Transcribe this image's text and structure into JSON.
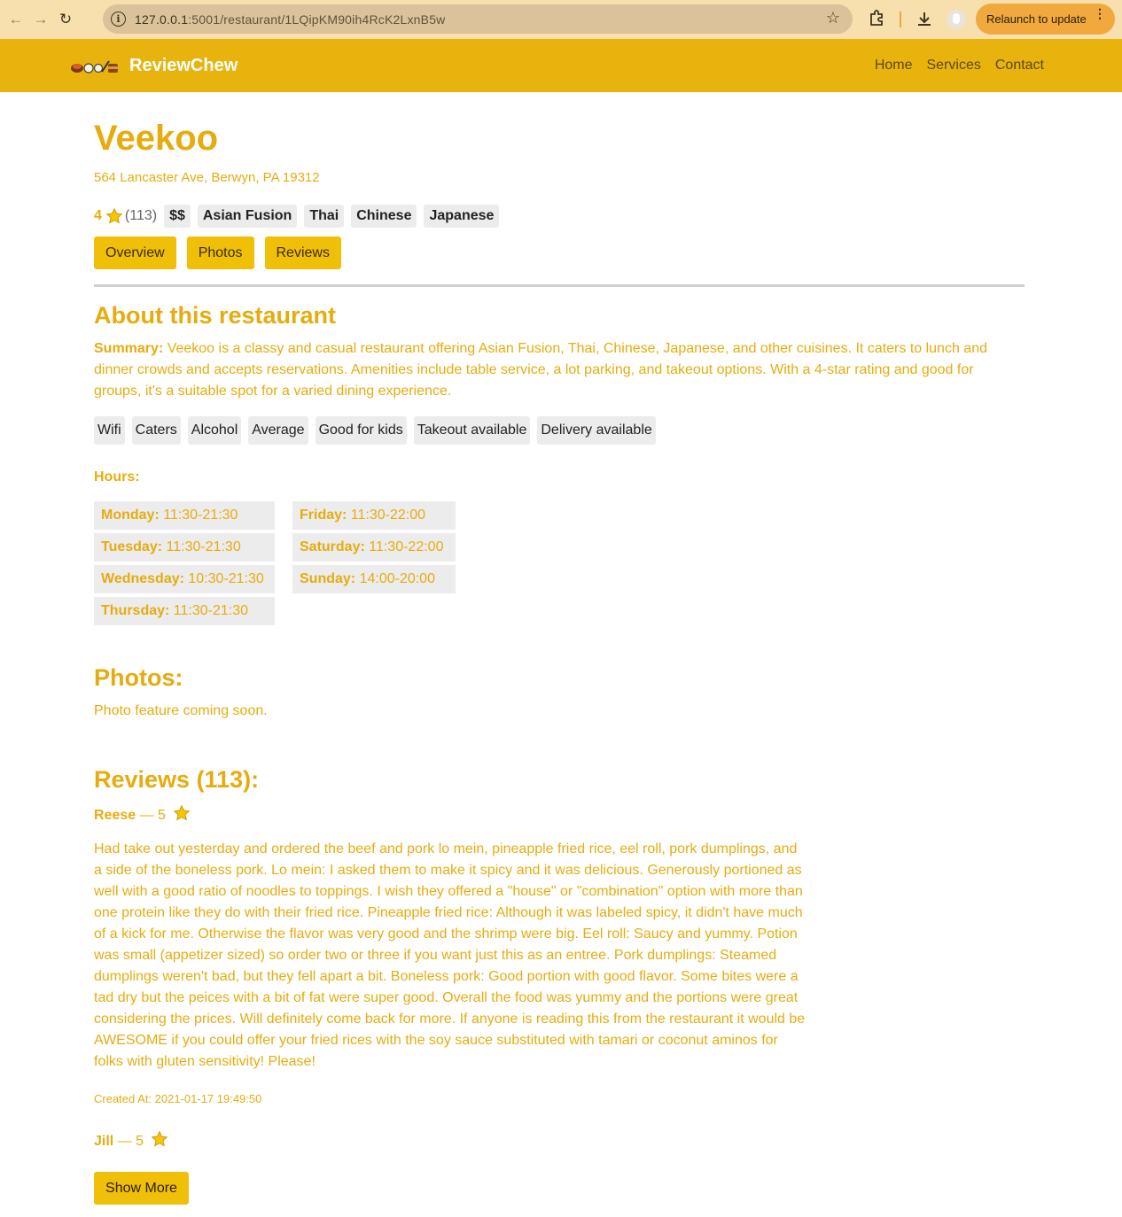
{
  "browser": {
    "url_host": "127.0.0.1",
    "url_path": ":5001/restaurant/1LQipKM90ih4RcK2LxnB5w",
    "relaunch_label": "Relaunch to update"
  },
  "navbar": {
    "brand": "ReviewChew",
    "links": [
      "Home",
      "Services",
      "Contact"
    ]
  },
  "restaurant": {
    "name": "Veekoo",
    "address": "564 Lancaster Ave, Berwyn, PA 19312",
    "rating": "4",
    "review_count": "(113)",
    "price": "$$",
    "categories": [
      "Asian Fusion",
      "Thai",
      "Chinese",
      "Japanese"
    ]
  },
  "tabs": [
    "Overview",
    "Photos",
    "Reviews"
  ],
  "about": {
    "heading": "About this restaurant",
    "summary_label": "Summary:",
    "summary_text": " Veekoo is a classy and casual restaurant offering Asian Fusion, Thai, Chinese, Japanese, and other cuisines. It caters to lunch and dinner crowds and accepts reservations. Amenities include table service, a lot parking, and takeout options. With a 4-star rating and good for groups, it's a suitable spot for a varied dining experience.",
    "amenities": [
      "Wifi",
      "Caters",
      "Alcohol",
      "Average",
      "Good for kids",
      "Takeout available",
      "Delivery available"
    ]
  },
  "hours": {
    "label": "Hours:",
    "days": [
      {
        "day": "Monday:",
        "time": " 11:30-21:30"
      },
      {
        "day": "Tuesday:",
        "time": " 11:30-21:30"
      },
      {
        "day": "Wednesday:",
        "time": " 10:30-21:30"
      },
      {
        "day": "Thursday:",
        "time": " 11:30-21:30"
      },
      {
        "day": "Friday:",
        "time": " 11:30-22:00"
      },
      {
        "day": "Saturday:",
        "time": " 11:30-22:00"
      },
      {
        "day": "Sunday:",
        "time": " 14:00-20:00"
      }
    ]
  },
  "photos": {
    "heading": "Photos:",
    "note": "Photo feature coming soon."
  },
  "reviews": {
    "heading": "Reviews (113):",
    "items": [
      {
        "author": "Reese",
        "rating_text": " — 5",
        "body": "Had take out yesterday and ordered the beef and pork lo mein, pineapple fried rice, eel roll, pork dumplings, and a side of the boneless pork. Lo mein: I asked them to make it spicy and it was delicious. Generously portioned as well with a good ratio of noodles to toppings. I wish they offered a \"house\" or \"combination\" option with more than one protein like they do with their fried rice. Pineapple fried rice: Although it was labeled spicy, it didn't have much of a kick for me. Otherwise the flavor was very good and the shrimp were big. Eel roll: Saucy and yummy. Potion was small (appetizer sized) so order two or three if you want just this as an entree. Pork dumplings: Steamed dumplings weren't bad, but they fell apart a bit. Boneless pork: Good portion with good flavor. Some bites were a tad dry but the peices with a bit of fat were super good. Overall the food was yummy and the portions were great considering the prices. Will definitely come back for more. If anyone is reading this from the restaurant it would be AWESOME if you could offer your fried rices with the soy sauce substituted with tamari or coconut aminos for folks with gluten sensitivity! Please!",
        "created": "Created At: 2021-01-17 19:49:50"
      },
      {
        "author": "Jill",
        "rating_text": " — 5"
      }
    ],
    "show_more": "Show More"
  },
  "colors": {
    "accent": "#e8b30d",
    "text_accent": "#e6ac0f",
    "button": "#f0bf07",
    "chrome": "#f7dfae"
  }
}
